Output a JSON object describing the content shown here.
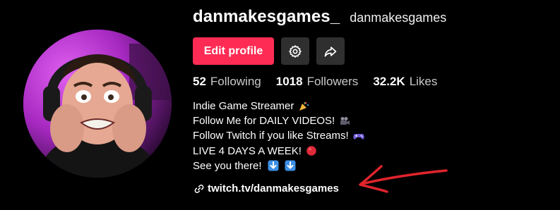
{
  "profile": {
    "username": "danmakesgames_",
    "nickname": "danmakesgames"
  },
  "actions": {
    "edit_label": "Edit profile",
    "settings_icon": "gear-icon",
    "share_icon": "share-arrow-icon"
  },
  "stats": {
    "following_count": "52",
    "following_label": "Following",
    "followers_count": "1018",
    "followers_label": "Followers",
    "likes_count": "32.2K",
    "likes_label": "Likes"
  },
  "bio": {
    "line1": "Indie Game Streamer",
    "line2": "Follow Me for DAILY VIDEOS!",
    "line3": "Follow Twitch if you like Streams!",
    "line4": "LIVE 4 DAYS A WEEK!",
    "line5": "See you there!"
  },
  "link": {
    "text": "twitch.tv/danmakesgames",
    "icon": "link-icon"
  },
  "colors": {
    "accent": "#fe2c55",
    "background": "#000000",
    "icon_button": "#2f2f2f",
    "annotation_arrow": "#e0242c"
  }
}
